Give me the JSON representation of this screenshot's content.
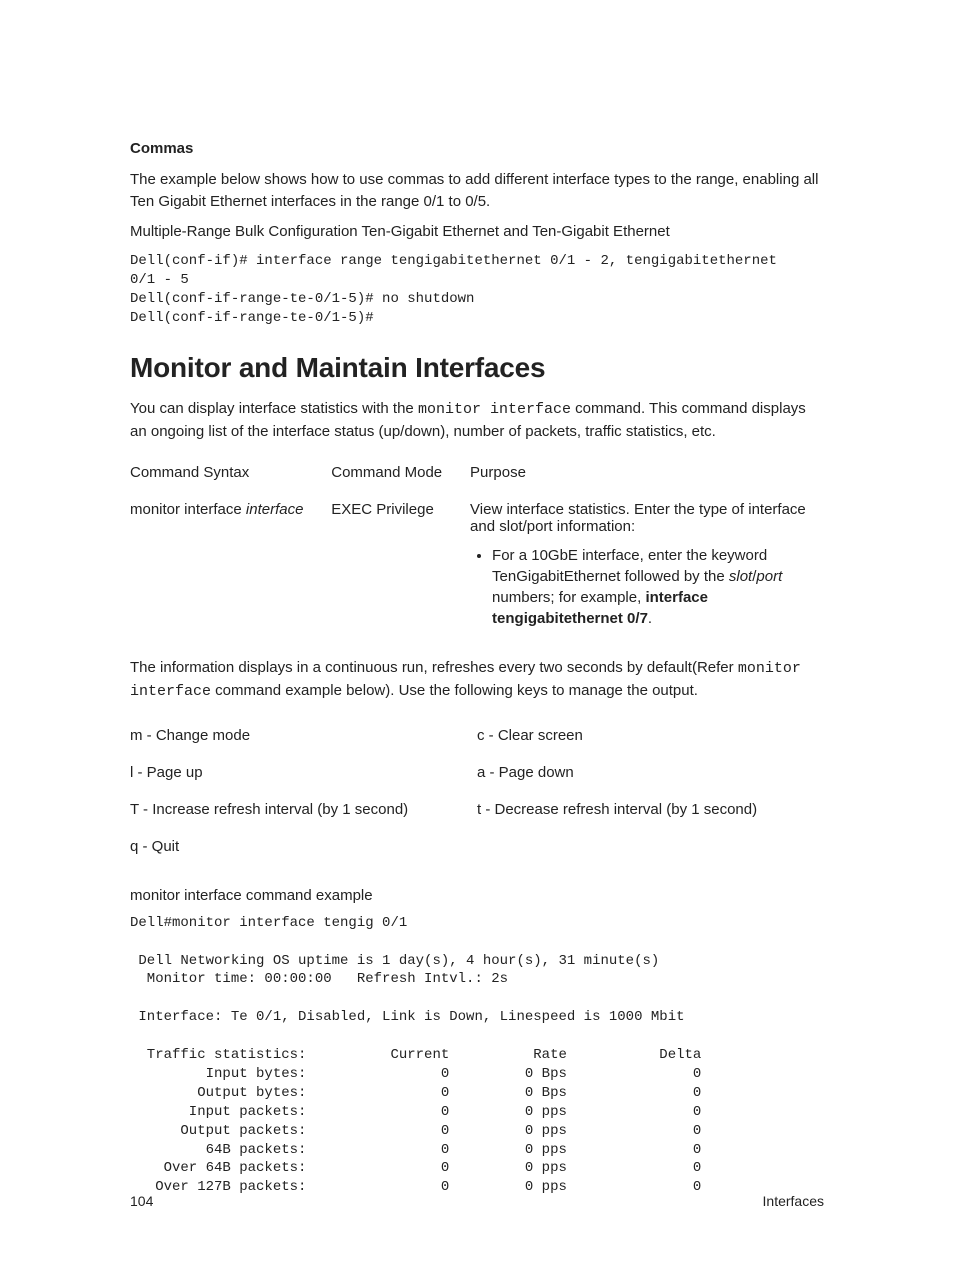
{
  "commas": {
    "heading": "Commas",
    "p1": "The example below shows how to use commas to add different interface types to the range, enabling all Ten Gigabit Ethernet interfaces in the range 0/1 to 0/5.",
    "p2": "Multiple-Range Bulk Configuration Ten-Gigabit Ethernet and Ten-Gigabit Ethernet",
    "code": "Dell(conf-if)# interface range tengigabitethernet 0/1 - 2, tengigabitethernet \n0/1 - 5\nDell(conf-if-range-te-0/1-5)# no shutdown\nDell(conf-if-range-te-0/1-5)#"
  },
  "monitor": {
    "title": "Monitor and Maintain Interfaces",
    "intro_pre": "You can display interface statistics with the ",
    "intro_cmd": "monitor interface",
    "intro_post": " command. This command displays an ongoing list of the interface status (up/down), number of packets, traffic statistics, etc.",
    "table": {
      "h1": "Command Syntax",
      "h2": "Command Mode",
      "h3": "Purpose",
      "syntax_pre": "monitor interface ",
      "syntax_ital": "interface",
      "mode": "EXEC Privilege",
      "purpose_p": "View interface statistics. Enter the type of interface and slot/port information:",
      "bullet_pre": "For a 10GbE interface, enter the keyword TenGigabitEthernet followed by the ",
      "bullet_ital1": "slot",
      "bullet_slash": "/",
      "bullet_ital2": "port",
      "bullet_mid": " numbers; for example, ",
      "bullet_bold": "interface tengigabitethernet 0/7",
      "bullet_dot": "."
    },
    "run_pre": "The information displays in a continuous run, refreshes every two seconds by default(Refer ",
    "run_cmd": "monitor interface",
    "run_post": " command example below). Use the following keys to manage the output.",
    "keys": {
      "r0c0": "m - Change mode",
      "r0c1": "c - Clear screen",
      "r1c0": "l - Page up",
      "r1c1": "a - Page down",
      "r2c0": "T - Increase refresh interval (by 1 second)",
      "r2c1": "t - Decrease refresh interval (by 1 second)",
      "r3c0": "q - Quit",
      "r3c1": ""
    },
    "example_label": "monitor interface command example",
    "example_code": "Dell#monitor interface tengig 0/1\n\n Dell Networking OS uptime is 1 day(s), 4 hour(s), 31 minute(s)\n  Monitor time: 00:00:00   Refresh Intvl.: 2s\n\n Interface: Te 0/1, Disabled, Link is Down, Linespeed is 1000 Mbit\n\n  Traffic statistics:          Current          Rate           Delta\n         Input bytes:                0         0 Bps               0\n        Output bytes:                0         0 Bps               0\n       Input packets:                0         0 pps               0\n      Output packets:                0         0 pps               0\n         64B packets:                0         0 pps               0\n    Over 64B packets:                0         0 pps               0\n   Over 127B packets:                0         0 pps               0"
  },
  "footer": {
    "page": "104",
    "section": "Interfaces"
  }
}
